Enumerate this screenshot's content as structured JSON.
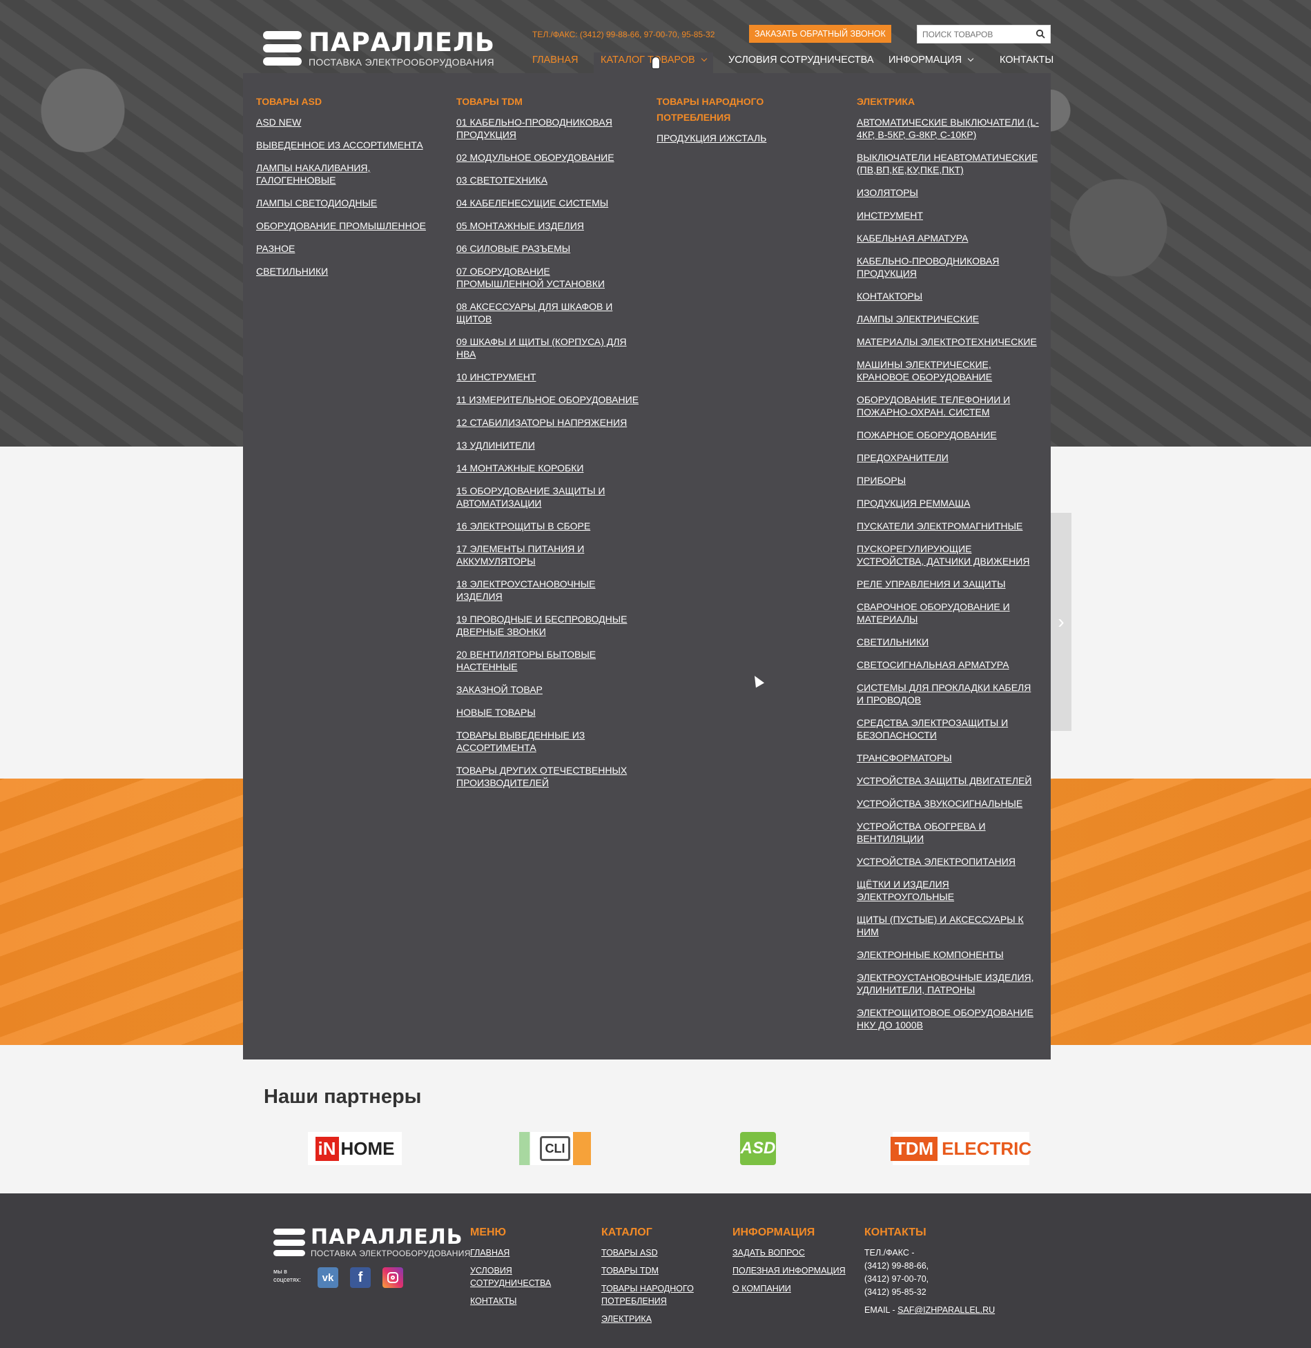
{
  "header": {
    "logo_main": "ПАРАЛЛЕЛЬ",
    "logo_sub": "ПОСТАВКА ЭЛЕКТРООБОРУДОВАНИЯ",
    "phone": "ТЕЛ./ФАКС: (3412) 99-88-66, 97-00-70, 95-85-32",
    "callback_label": "ЗАКАЗАТЬ ОБРАТНЫЙ ЗВОНОК",
    "search_placeholder": "ПОИСК ТОВАРОВ",
    "nav": {
      "home": "ГЛАВНАЯ",
      "catalog": "КАТАЛОГ ТОВАРОВ",
      "terms": "УСЛОВИЯ СОТРУДНИЧЕСТВА",
      "info": "ИНФОРМАЦИЯ",
      "contacts": "КОНТАКТЫ"
    }
  },
  "mega_menu": {
    "asd": {
      "title": "ТОВАРЫ ASD",
      "items": [
        "ASD NEW",
        "ВЫВЕДЕННОЕ ИЗ АССОРТИМЕНТА",
        "ЛАМПЫ НАКАЛИВАНИЯ, ГАЛОГЕННОВЫЕ",
        "ЛАМПЫ СВЕТОДИОДНЫЕ",
        "ОБОРУДОВАНИЕ ПРОМЫШЛЕННОЕ",
        "РАЗНОЕ",
        "СВЕТИЛЬНИКИ"
      ]
    },
    "tdm": {
      "title": "ТОВАРЫ TDM",
      "items": [
        "01 КАБЕЛЬНО-ПРОВОДНИКОВАЯ ПРОДУКЦИЯ",
        "02 МОДУЛЬНОЕ ОБОРУДОВАНИЕ",
        "03 СВЕТОТЕХНИКА",
        "04 КАБЕЛЕНЕСУЩИЕ СИСТЕМЫ",
        "05 МОНТАЖНЫЕ ИЗДЕЛИЯ",
        "06 СИЛОВЫЕ РАЗЪЕМЫ",
        "07 ОБОРУДОВАНИЕ ПРОМЫШЛЕННОЙ УСТАНОВКИ",
        "08 АКСЕССУАРЫ ДЛЯ ШКАФОВ И ЩИТОВ",
        "09 ШКАФЫ И ЩИТЫ (КОРПУСА) ДЛЯ НВА",
        "10 ИНСТРУМЕНТ",
        "11 ИЗМЕРИТЕЛЬНОЕ ОБОРУДОВАНИЕ",
        "12 СТАБИЛИЗАТОРЫ НАПРЯЖЕНИЯ",
        "13 УДЛИНИТЕЛИ",
        "14 МОНТАЖНЫЕ КОРОБКИ",
        "15 ОБОРУДОВАНИЕ ЗАЩИТЫ И АВТОМАТИЗАЦИИ",
        "16 ЭЛЕКТРОЩИТЫ В СБОРЕ",
        "17 ЭЛЕМЕНТЫ ПИТАНИЯ И АККУМУЛЯТОРЫ",
        "18 ЭЛЕКТРОУСТАНОВОЧНЫЕ ИЗДЕЛИЯ",
        "19 ПРОВОДНЫЕ И БЕСПРОВОДНЫЕ ДВЕРНЫЕ ЗВОНКИ",
        "20 ВЕНТИЛЯТОРЫ БЫТОВЫЕ НАСТЕННЫЕ",
        "ЗАКАЗНОЙ ТОВАР",
        "НОВЫЕ ТОВАРЫ",
        "ТОВАРЫ ВЫВЕДЕННЫЕ ИЗ АССОРТИМЕНТА",
        "ТОВАРЫ ДРУГИХ ОТЕЧЕСТВЕННЫХ ПРОИЗВОДИТЕЛЕЙ"
      ]
    },
    "consumer": {
      "title": "ТОВАРЫ НАРОДНОГО ПОТРЕБЛЕНИЯ",
      "items": [
        "ПРОДУКЦИЯ ИЖСТАЛЬ"
      ]
    },
    "electrics": {
      "title": "ЭЛЕКТРИКА",
      "items": [
        "АВТОМАТИЧЕСКИЕ ВЫКЛЮЧАТЕЛИ (L-4КР, B-5КР, G-8КР, C-10КР)",
        "ВЫКЛЮЧАТЕЛИ НЕАВТОМАТИЧЕСКИЕ (ПВ,ВП,КЕ,КУ,ПКЕ,ПКТ)",
        "ИЗОЛЯТОРЫ",
        "ИНСТРУМЕНТ",
        "КАБЕЛЬНАЯ АРМАТУРА",
        "КАБЕЛЬНО-ПРОВОДНИКОВАЯ ПРОДУКЦИЯ",
        "КОНТАКТОРЫ",
        "ЛАМПЫ ЭЛЕКТРИЧЕСКИЕ",
        "МАТЕРИАЛЫ ЭЛЕКТРОТЕХНИЧЕСКИЕ",
        "МАШИНЫ ЭЛЕКТРИЧЕСКИЕ, КРАНОВОЕ ОБОРУДОВАНИЕ",
        "ОБОРУДОВАНИЕ ТЕЛЕФОНИИ И ПОЖАРНО-ОХРАН. СИСТЕМ",
        "ПОЖАРНОЕ ОБОРУДОВАНИЕ",
        "ПРЕДОХРАНИТЕЛИ",
        "ПРИБОРЫ",
        "ПРОДУКЦИЯ РЕММАША",
        "ПУСКАТЕЛИ ЭЛЕКТРОМАГНИТНЫЕ",
        "ПУСКОРЕГУЛИРУЮЩИЕ УСТРОЙСТВА, ДАТЧИКИ ДВИЖЕНИЯ",
        "РЕЛЕ УПРАВЛЕНИЯ И ЗАЩИТЫ",
        "СВАРОЧНОЕ ОБОРУДОВАНИЕ И МАТЕРИАЛЫ",
        "СВЕТИЛЬНИКИ",
        "СВЕТОСИГНАЛЬНАЯ АРМАТУРА",
        "СИСТЕМЫ ДЛЯ ПРОКЛАДКИ КАБЕЛЯ И ПРОВОДОВ",
        "СРЕДСТВА ЭЛЕКТРОЗАЩИТЫ И БЕЗОПАСНОСТИ",
        "ТРАНСФОРМАТОРЫ",
        "УСТРОЙСТВА ЗАЩИТЫ ДВИГАТЕЛЕЙ",
        "УСТРОЙСТВА ЗВУКОСИГНАЛЬНЫЕ",
        "УСТРОЙСТВА ОБОГРЕВА И ВЕНТИЛЯЦИИ",
        "УСТРОЙСТВА ЭЛЕКТРОПИТАНИЯ",
        "ЩЁТКИ И ИЗДЕЛИЯ ЭЛЕКТРОУГОЛЬНЫЕ",
        "ЩИТЫ (ПУСТЫЕ) И АКСЕССУАРЫ К НИМ",
        "ЭЛЕКТРОННЫЕ КОМПОНЕНТЫ",
        "ЭЛЕКТРОУСТАНОВОЧНЫЕ ИЗДЕЛИЯ, УДЛИНИТЕЛИ, ПАТРОНЫ",
        "ЭЛЕКТРОЩИТОВОЕ ОБОРУДОВАНИЕ НКУ ДО 1000В"
      ]
    }
  },
  "partners": {
    "title": "Наши партнеры",
    "inhome_in": "iN",
    "inhome_home": "HOME",
    "cli": "CLI",
    "asd": "ASD",
    "tdm": "TDM",
    "tdm_electric": "ELECTRIC"
  },
  "footer": {
    "logo_main": "ПАРАЛЛЕЛЬ",
    "logo_sub": "ПОСТАВКА ЭЛЕКТРООБОРУДОВАНИЯ",
    "social_label": "мы в соцсетях:",
    "menu": {
      "title": "МЕНЮ",
      "items": [
        "ГЛАВНАЯ",
        "УСЛОВИЯ СОТРУДНИЧЕСТВА",
        "КОНТАКТЫ"
      ]
    },
    "catalog": {
      "title": "КАТАЛОГ",
      "items": [
        "ТОВАРЫ ASD",
        "ТОВАРЫ TDM",
        "ТОВАРЫ НАРОДНОГО ПОТРЕБЛЕНИЯ",
        "ЭЛЕКТРИКА"
      ]
    },
    "info": {
      "title": "ИНФОРМАЦИЯ",
      "items": [
        "ЗАДАТЬ ВОПРОС",
        "ПОЛЕЗНАЯ ИНФОРМАЦИЯ",
        "О КОМПАНИИ"
      ]
    },
    "contacts": {
      "title": "КОНТАКТЫ",
      "phone_label": "ТЕЛ./ФАКС -",
      "phones": [
        "(3412) 99-88-66,",
        "(3412) 97-00-70,",
        "(3412) 95-85-32"
      ],
      "email_label": "EMAIL -",
      "email": "SAF@IZHPARALLEL.RU"
    }
  },
  "colors": {
    "accent": "#f28a26",
    "menu_bg": "#4a494d",
    "footer_bg": "#3f3e42"
  },
  "icons": {
    "search": "search-icon",
    "vk": "vk-icon",
    "facebook": "facebook-icon",
    "instagram": "instagram-icon",
    "slider_next": "chevron-right-icon"
  }
}
